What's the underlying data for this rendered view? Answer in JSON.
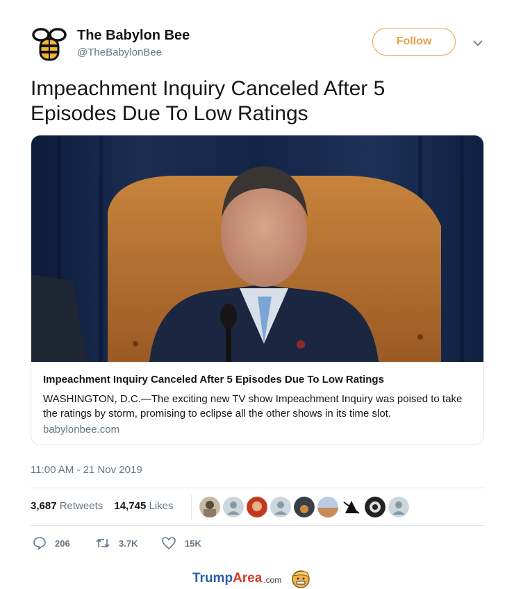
{
  "tweet": {
    "author_name": "The Babylon Bee",
    "author_handle": "@TheBabylonBee",
    "follow_label": "Follow",
    "text": "Impeachment Inquiry Canceled After 5 Episodes Due To Low Ratings",
    "timestamp": "11:00 AM - 21 Nov 2019"
  },
  "card": {
    "title": "Impeachment Inquiry Canceled After 5 Episodes Due To Low Ratings",
    "description": "WASHINGTON, D.C.—The exciting new TV show Impeachment Inquiry was poised to take the ratings by storm, promising to eclipse all the other shows in its time slot.",
    "domain": "babylonbee.com",
    "image_icon": "news-photo"
  },
  "stats": {
    "retweets_count": "3,687",
    "retweets_label": "Retweets",
    "likes_count": "14,745",
    "likes_label": "Likes"
  },
  "actions": {
    "reply_count": "206",
    "retweet_count": "3.7K",
    "like_count": "15K"
  },
  "watermark": {
    "part1": "Trump",
    "part2": "Area",
    "part3": ".com"
  },
  "colors": {
    "accent": "#e5a04a",
    "muted": "#657786",
    "border": "#e1e8ed"
  }
}
